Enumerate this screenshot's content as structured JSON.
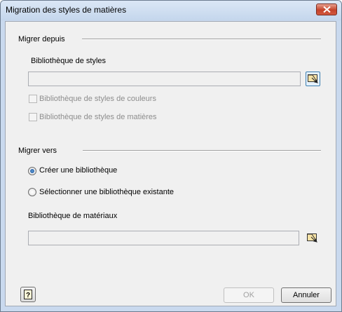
{
  "window": {
    "title": "Migration des styles de matières",
    "close_icon": "close-icon"
  },
  "migrate_from": {
    "group_label": "Migrer depuis",
    "style_library_label": "Bibliothèque de styles",
    "style_library_value": "",
    "browse_icon": "folder-browse-icon",
    "color_styles_checkbox": {
      "label": "Bibliothèque de styles de couleurs",
      "checked": false,
      "enabled": false
    },
    "material_styles_checkbox": {
      "label": "Bibliothèque de styles de matières",
      "checked": false,
      "enabled": false
    }
  },
  "migrate_to": {
    "group_label": "Migrer vers",
    "options": [
      {
        "label": "Créer une bibliothèque",
        "selected": true
      },
      {
        "label": "Sélectionner une bibliothèque existante",
        "selected": false
      }
    ],
    "material_library_label": "Bibliothèque de matériaux",
    "material_library_value": "",
    "browse_icon": "folder-browse-icon"
  },
  "footer": {
    "help_icon": "help-icon",
    "ok_label": "OK",
    "ok_enabled": false,
    "cancel_label": "Annuler"
  },
  "colors": {
    "titlebar": "#c9d9ee",
    "dialog_background": "#f0f0f0",
    "close_button": "#c4422a",
    "radio_selected": "#1c4f95"
  }
}
